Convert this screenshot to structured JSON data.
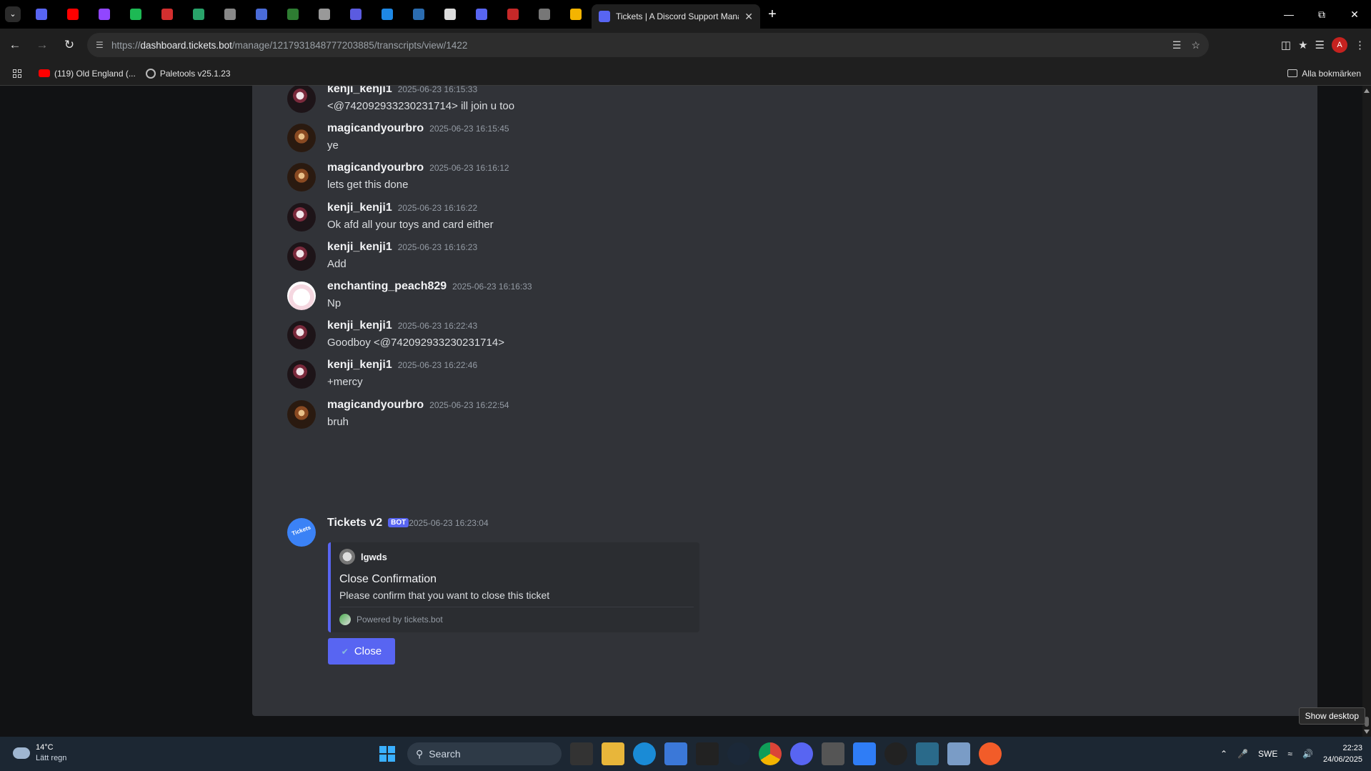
{
  "browser": {
    "active_tab_title": "Tickets | A Discord Support Manager",
    "url_prefix": "https://",
    "url_host": "dashboard.tickets.bot",
    "url_path": "/manage/1217931848777203885/transcripts/view/1422",
    "profile_initial": "A",
    "pinned_tab_icons": [
      "discord-icon",
      "youtube-icon",
      "twitch-icon",
      "spotify-icon",
      "wdc-icon",
      "mail-icon",
      "circle-icon",
      "pattern-icon",
      "alphabet-icon",
      "web-icon",
      "x-box-icon",
      "cloud-icon",
      "nav-icon",
      "x-logo-icon",
      "discord-icon",
      "flag-icon",
      "game-icon",
      "gamepad-icon"
    ]
  },
  "bookmarks": {
    "items": [
      {
        "label": "(119) Old England (...",
        "icon": "youtube-icon"
      },
      {
        "label": "Paletools v25.1.23",
        "icon": "paletools-icon"
      }
    ],
    "all_bookmarks": "Alla bokmärken"
  },
  "transcript": {
    "messages": [
      {
        "author": "kenji_kenji1",
        "timestamp": "2025-06-23 16:15:33",
        "content": "<@742092933230231714> ill join u too",
        "avatar": "kenji"
      },
      {
        "author": "magicandyourbro",
        "timestamp": "2025-06-23 16:15:45",
        "content": "ye",
        "avatar": "magic"
      },
      {
        "author": "magicandyourbro",
        "timestamp": "2025-06-23 16:16:12",
        "content": "lets get this done",
        "avatar": "magic"
      },
      {
        "author": "kenji_kenji1",
        "timestamp": "2025-06-23 16:16:22",
        "content": "Ok afd all your toys and card either",
        "avatar": "kenji"
      },
      {
        "author": "kenji_kenji1",
        "timestamp": "2025-06-23 16:16:23",
        "content": "Add",
        "avatar": "kenji"
      },
      {
        "author": "enchanting_peach829",
        "timestamp": "2025-06-23 16:16:33",
        "content": "Np",
        "avatar": "peach"
      },
      {
        "author": "kenji_kenji1",
        "timestamp": "2025-06-23 16:22:43",
        "content": "Goodboy <@742092933230231714>",
        "avatar": "kenji"
      },
      {
        "author": "kenji_kenji1",
        "timestamp": "2025-06-23 16:22:46",
        "content": "+mercy",
        "avatar": "kenji"
      },
      {
        "author": "magicandyourbro",
        "timestamp": "2025-06-23 16:22:54",
        "content": "bruh",
        "avatar": "magic"
      }
    ],
    "bot_message": {
      "author": "Tickets v2",
      "badge": "BOT",
      "timestamp": "2025-06-23 16:23:04",
      "avatar_text": "Tickets",
      "embed": {
        "author": "lgwds",
        "title": "Close Confirmation",
        "description": "Please confirm that you want to close this ticket",
        "footer": "Powered by tickets.bot",
        "accent_color": "#5865f2"
      },
      "button_label": "Close"
    }
  },
  "taskbar": {
    "weather_temp": "14°C",
    "weather_desc": "Lätt regn",
    "search_placeholder": "Search",
    "language": "SWE",
    "time": "22:23",
    "date": "24/06/2025",
    "tooltip": "Show desktop"
  }
}
